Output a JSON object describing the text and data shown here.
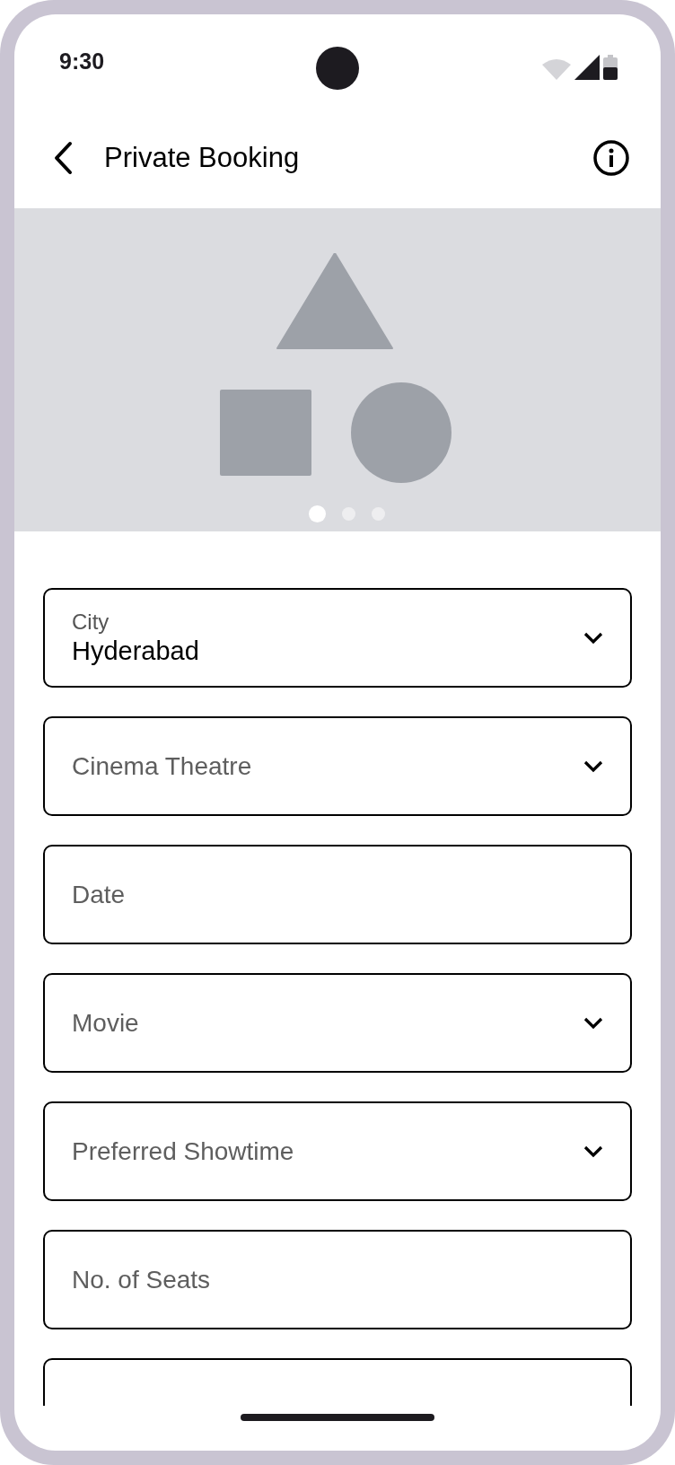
{
  "status_bar": {
    "time": "9:30"
  },
  "app_bar": {
    "title": "Private Booking"
  },
  "carousel": {
    "dots": [
      {
        "selected": true
      },
      {
        "selected": false
      },
      {
        "selected": false
      }
    ]
  },
  "fields": [
    {
      "kind": "dropdown",
      "label": "City",
      "value": "Hyderabad"
    },
    {
      "kind": "dropdown",
      "placeholder": "Cinema Theatre"
    },
    {
      "kind": "text",
      "placeholder": "Date"
    },
    {
      "kind": "dropdown",
      "placeholder": "Movie"
    },
    {
      "kind": "dropdown",
      "placeholder": "Preferred Showtime"
    },
    {
      "kind": "text",
      "placeholder": "No. of Seats"
    },
    {
      "kind": "text"
    }
  ]
}
